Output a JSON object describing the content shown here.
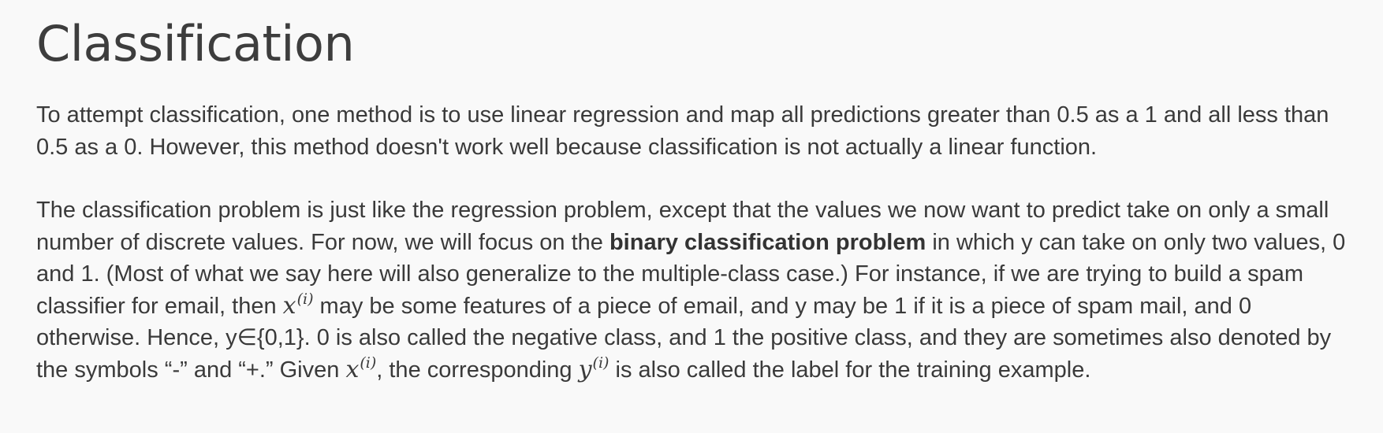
{
  "title": "Classification",
  "paragraph1": "To attempt classification, one method is to use linear regression and map all predictions greater than 0.5 as a 1 and all less than 0.5 as a 0. However, this method doesn't work well because classification is not actually a linear function.",
  "paragraph2": {
    "text1": "The classification problem is just like the regression problem, except that the values we now want to predict take on only a small number of discrete values. For now, we will focus on the ",
    "bold": "binary classification problem",
    "text2": " in which y can take on only two values, 0 and 1. (Most of what we say here will also generalize to the multiple-class case.) For instance, if we are trying to build a spam classifier for email, then ",
    "math1_base": "x",
    "math1_sup": "(i)",
    "text3": " may be some features of a piece of email, and y may be 1 if it is a piece of spam mail, and 0 otherwise. Hence, y∈{0,1}. 0 is also called the negative class, and 1 the positive class, and they are sometimes also denoted by the symbols “-” and “+.” Given ",
    "math2_base": "x",
    "math2_sup": "(i)",
    "text4": ", the corresponding ",
    "math3_base": "y",
    "math3_sup": "(i)",
    "text5": " is also called the label for the training example."
  }
}
